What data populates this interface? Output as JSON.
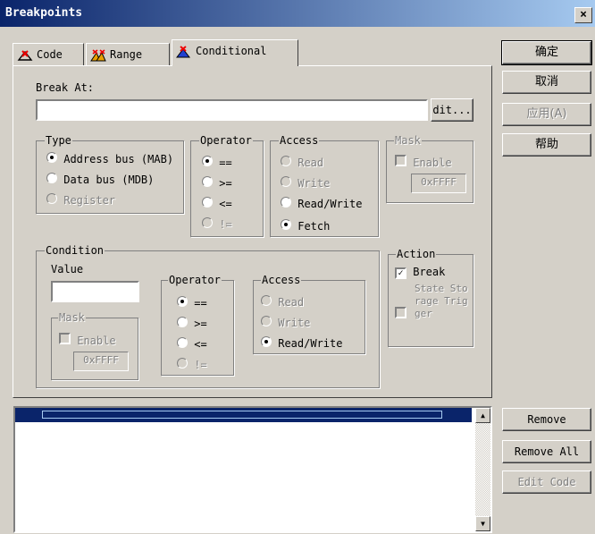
{
  "window": {
    "title": "Breakpoints",
    "close_glyph": "×"
  },
  "tabs": [
    {
      "label": "Code",
      "icon": "code-tab-icon"
    },
    {
      "label": "Range",
      "icon": "range-tab-icon"
    },
    {
      "label": "Conditional",
      "icon": "conditional-tab-icon"
    }
  ],
  "dialog_buttons": {
    "ok": "确定",
    "cancel": "取消",
    "apply": "应用(A)",
    "help": "帮助"
  },
  "break_at": {
    "label": "Break At:",
    "value": "",
    "edit_button": "dit..."
  },
  "type_group": {
    "title": "Type",
    "options": [
      {
        "label": "Address bus (MAB)",
        "checked": true,
        "enabled": true
      },
      {
        "label": "Data bus (MDB)",
        "checked": false,
        "enabled": true
      },
      {
        "label": "Register",
        "checked": false,
        "enabled": false
      }
    ]
  },
  "operator_group": {
    "title": "Operator",
    "options": [
      {
        "label": "==",
        "checked": true,
        "enabled": true
      },
      {
        "label": ">=",
        "checked": false,
        "enabled": true
      },
      {
        "label": "<=",
        "checked": false,
        "enabled": true
      },
      {
        "label": "!=",
        "checked": false,
        "enabled": false
      }
    ]
  },
  "access_group": {
    "title": "Access",
    "options": [
      {
        "label": "Read",
        "checked": false,
        "enabled": false
      },
      {
        "label": "Write",
        "checked": false,
        "enabled": false
      },
      {
        "label": "Read/Write",
        "checked": false,
        "enabled": true
      },
      {
        "label": "Fetch",
        "checked": true,
        "enabled": true
      }
    ]
  },
  "mask_group": {
    "title": "Mask",
    "enable_label": "Enable",
    "value": "0xFFFF"
  },
  "condition_group": {
    "title": "Condition",
    "value_label": "Value",
    "value": "",
    "mask": {
      "title": "Mask",
      "enable_label": "Enable",
      "value": "0xFFFF"
    },
    "operator": {
      "title": "Operator",
      "options": [
        {
          "label": "==",
          "checked": true,
          "enabled": true
        },
        {
          "label": ">=",
          "checked": false,
          "enabled": true
        },
        {
          "label": "<=",
          "checked": false,
          "enabled": true
        },
        {
          "label": "!=",
          "checked": false,
          "enabled": false
        }
      ]
    },
    "access": {
      "title": "Access",
      "options": [
        {
          "label": "Read",
          "checked": false,
          "enabled": false
        },
        {
          "label": "Write",
          "checked": false,
          "enabled": false
        },
        {
          "label": "Read/Write",
          "checked": true,
          "enabled": true
        }
      ]
    }
  },
  "action_group": {
    "title": "Action",
    "break_label": "Break",
    "break_checked": true,
    "state_storage_label": "State Storage Trigger",
    "state_storage_checked": false
  },
  "list_buttons": {
    "remove": "Remove",
    "remove_all": "Remove All",
    "edit_code": "Edit Code"
  },
  "list": {
    "items": []
  }
}
